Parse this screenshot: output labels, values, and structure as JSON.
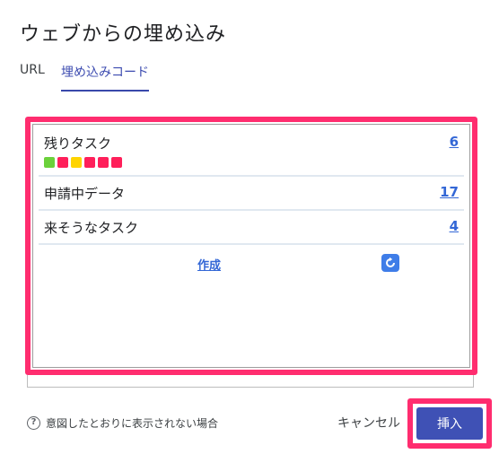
{
  "dialog": {
    "title": "ウェブからの埋め込み"
  },
  "tabs": [
    {
      "label": "URL",
      "active": false
    },
    {
      "label": "埋め込みコード",
      "active": true
    }
  ],
  "embed": {
    "rows": [
      {
        "label": "残りタスク",
        "count": "6"
      },
      {
        "label": "申請中データ",
        "count": "17"
      },
      {
        "label": "来そうなタスク",
        "count": "4"
      }
    ],
    "swatches": [
      {
        "color": "#6bd13b"
      },
      {
        "color": "#ff1f5a"
      },
      {
        "color": "#ffd400"
      },
      {
        "color": "#ff1f5a"
      },
      {
        "color": "#ff1f5a"
      },
      {
        "color": "#ff1f5a"
      }
    ],
    "create_label": "作成",
    "refresh_icon": "refresh-icon"
  },
  "footer": {
    "help_icon": "question-circle-icon",
    "help_text": "意図したとおりに表示されない場合",
    "cancel_label": "キャンセル",
    "insert_label": "挿入"
  },
  "colors": {
    "highlight": "#ff2d6f",
    "primary": "#3f51b5",
    "link": "#3367d6"
  }
}
